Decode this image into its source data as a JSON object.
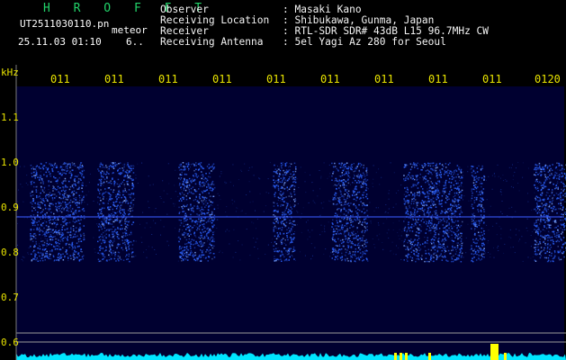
{
  "header": {
    "app_name": "H R O F F T",
    "file_name": "UT2511030110.pn",
    "file_tag": "meteor",
    "time_label": "25.11.03 01:10",
    "count_label": "6.."
  },
  "info": [
    {
      "label": "Observer",
      "value": ": Masaki Kano"
    },
    {
      "label": "Receiving Location",
      "value": ": Shibukawa, Gunma, Japan"
    },
    {
      "label": "Receiver",
      "value": ": RTL-SDR SDR# 43dB L15 96.7MHz CW"
    },
    {
      "label": "Receiving Antenna",
      "value": ": 5el Yagi Az 280 for Seoul"
    }
  ],
  "spectrogram": {
    "unit_label": "kHz",
    "time_ticks": [
      "011",
      "011",
      "011",
      "011",
      "011",
      "011",
      "011",
      "011",
      "011",
      "0120"
    ],
    "freq_ticks": [
      "1.1",
      "1.0",
      "0.9",
      "0.8",
      "0.7",
      "0.6"
    ],
    "colors": {
      "background": "#000030",
      "signal": "#2b63ff",
      "baseline": "#00e5ff",
      "peak": "#ffff00",
      "labels": "#e8e300"
    },
    "bursts_seconds": [
      {
        "start": 3,
        "end": 15
      },
      {
        "start": 18,
        "end": 26
      },
      {
        "start": 36,
        "end": 44
      },
      {
        "start": 57,
        "end": 62
      },
      {
        "start": 70,
        "end": 78
      },
      {
        "start": 86,
        "end": 99
      },
      {
        "start": 101,
        "end": 104
      },
      {
        "start": 115,
        "end": 129
      },
      {
        "start": 133,
        "end": 136
      }
    ],
    "noise_band_khz": [
      0.78,
      1.0
    ],
    "carrier_khz": 0.875
  }
}
